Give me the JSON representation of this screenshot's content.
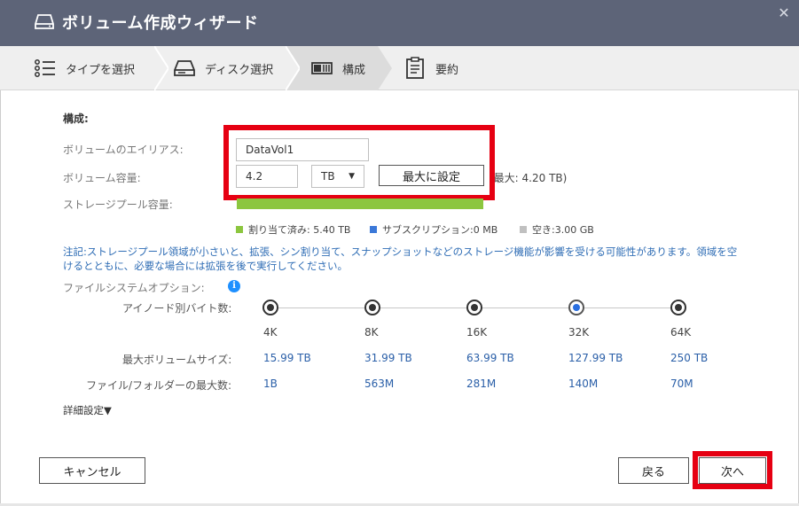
{
  "window": {
    "title": "ボリューム作成ウィザード",
    "close_glyph": "✕"
  },
  "steps": [
    {
      "label": "タイプを選択",
      "icon": "list-icon"
    },
    {
      "label": "ディスク選択",
      "icon": "disk-icon"
    },
    {
      "label": "構成",
      "icon": "configure-icon",
      "active": true
    },
    {
      "label": "要約",
      "icon": "clipboard-icon"
    }
  ],
  "form": {
    "section_title": "構成:",
    "alias_label": "ボリュームのエイリアス:",
    "alias_value": "DataVol1",
    "capacity_label": "ボリューム容量:",
    "capacity_value": "4.2",
    "unit_value": "TB",
    "set_max_label": "最大に設定",
    "max_text": "(最大: 4.20 TB)",
    "pool_label": "ストレージプール容量:"
  },
  "pool": {
    "allocated_fraction": 1.0,
    "legend": [
      {
        "text": "割り当て済み: 5.40 TB",
        "color": "#8cc63f"
      },
      {
        "text": "サブスクリプション:0 MB",
        "color": "#3b78d8"
      },
      {
        "text": "空き:3.00 GB",
        "color": "#c0c0c0"
      }
    ]
  },
  "note": "注記:ストレージプール領域が小さいと、拡張、シン割り当て、スナップショットなどのストレージ機能が影響を受ける可能性があります。領域を空けるとともに、必要な場合には拡張を後で実行してください。",
  "fs": {
    "options_label": "ファイルシステムオプション:",
    "inode_label": "アイノード別バイト数:",
    "max_volume_label": "最大ボリュームサイズ:",
    "max_files_label": "ファイル/フォルダーの最大数:",
    "selected_index": 3,
    "columns": [
      {
        "size": "4K",
        "max_volume": "15.99 TB",
        "max_files": "1B"
      },
      {
        "size": "8K",
        "max_volume": "31.99 TB",
        "max_files": "563M"
      },
      {
        "size": "16K",
        "max_volume": "63.99 TB",
        "max_files": "281M"
      },
      {
        "size": "32K",
        "max_volume": "127.99 TB",
        "max_files": "140M"
      },
      {
        "size": "64K",
        "max_volume": "250 TB",
        "max_files": "70M"
      }
    ]
  },
  "advanced_label": "詳細設定▼",
  "buttons": {
    "cancel": "キャンセル",
    "back": "戻る",
    "next": "次へ"
  },
  "colors": {
    "title_bar": "#5d6478",
    "highlight": "#e60012",
    "link_blue": "#2a5fa8"
  }
}
